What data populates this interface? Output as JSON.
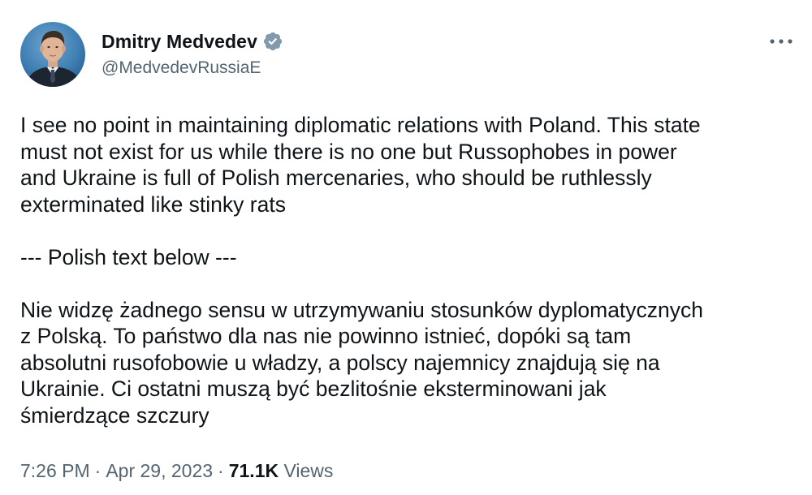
{
  "author": {
    "display_name": "Dmitry Medvedev",
    "handle": "@MedvedevRussiaE",
    "verified": true,
    "verified_badge_color": "#829aab",
    "avatar_icon": "profile-photo"
  },
  "menu": {
    "icon": "more-horizontal-icon"
  },
  "post": {
    "paragraph_en_lines": [
      "I see no point in maintaining diplomatic relations with Poland. This state",
      "must not exist for us while there is no one but Russophobes in power",
      "and Ukraine is full of Polish mercenaries, who should be ruthlessly",
      "exterminated like stinky rats"
    ],
    "separator": "--- Polish text below ---",
    "paragraph_pl_lines": [
      "Nie widzę żadnego sensu w utrzymywaniu stosunków dyplomatycznych",
      "z Polską. To państwo dla nas nie powinno istnieć, dopóki są tam",
      "absolutni rusofobowie u władzy, a polscy najemnicy znajdują się na",
      "Ukrainie. Ci ostatni muszą być bezlitośnie eksterminowani jak",
      "śmierdzące szczury"
    ]
  },
  "meta": {
    "time": "7:26 PM",
    "separator": "·",
    "date": "Apr 29, 2023",
    "views_count": "71.1K",
    "views_label": "Views"
  },
  "colors": {
    "text_primary": "#0f1419",
    "text_secondary": "#536471"
  }
}
